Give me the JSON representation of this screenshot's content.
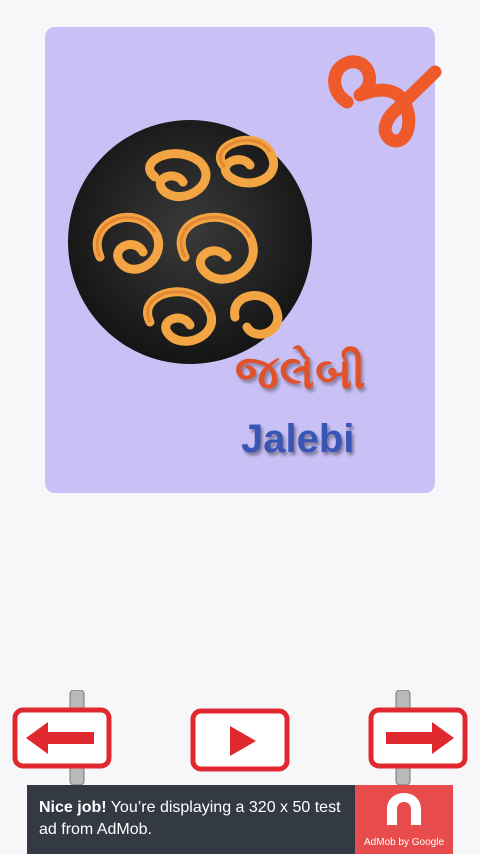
{
  "card": {
    "letter": "જ",
    "word_gujarati": "જલેબી",
    "word_english": "Jalebi",
    "image": "jalebi-plate"
  },
  "nav": {
    "previous": "arrow-left-icon",
    "play": "play-icon",
    "next": "arrow-right-icon"
  },
  "ad": {
    "headline": "Nice job!",
    "body": " You’re displaying a 320 x 50 test ad from AdMob.",
    "brand": "AdMob by Google"
  },
  "colors": {
    "card_bg": "#c9c1f6",
    "letter": "#ee5a2a",
    "gujarati_word": "#e2522a",
    "english_word": "#3a56b5",
    "ad_bg": "#333a44",
    "ad_logo_bg": "#e84b4b",
    "sign_red": "#e0292f"
  }
}
